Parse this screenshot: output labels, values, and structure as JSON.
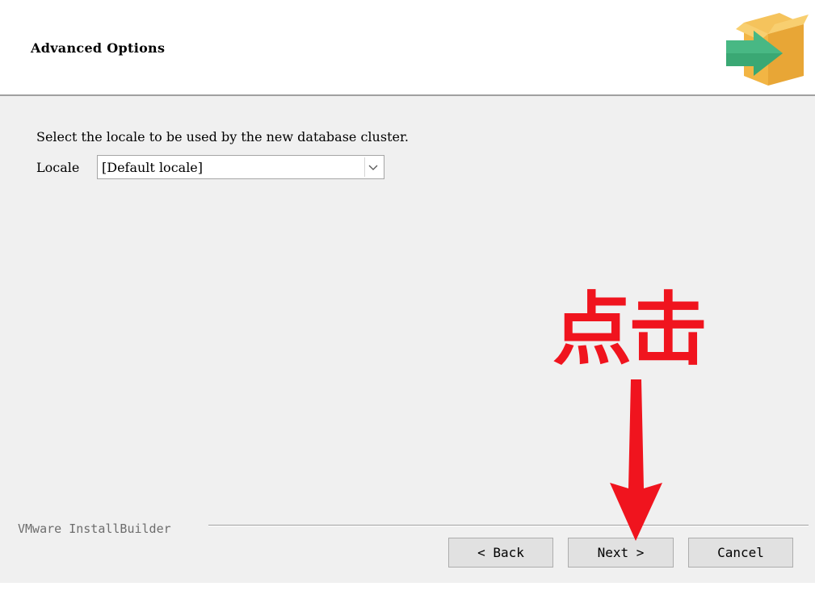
{
  "header": {
    "title": "Advanced Options",
    "icon": "installer-box-arrow-icon"
  },
  "main": {
    "instruction": "Select the locale to be used by the new database cluster.",
    "locale_label": "Locale",
    "locale_value": "[Default locale]"
  },
  "footer": {
    "brand": "VMware InstallBuilder",
    "back_label": "< Back",
    "next_label": "Next >",
    "cancel_label": "Cancel"
  },
  "annotation": {
    "text": "点击",
    "color": "#f0141e",
    "icon": "red-down-arrow-icon"
  },
  "colors": {
    "content_bg": "#f0f0f0",
    "header_bg": "#ffffff",
    "box_yellow": "#f2b544",
    "arrow_green": "#3aa874"
  }
}
